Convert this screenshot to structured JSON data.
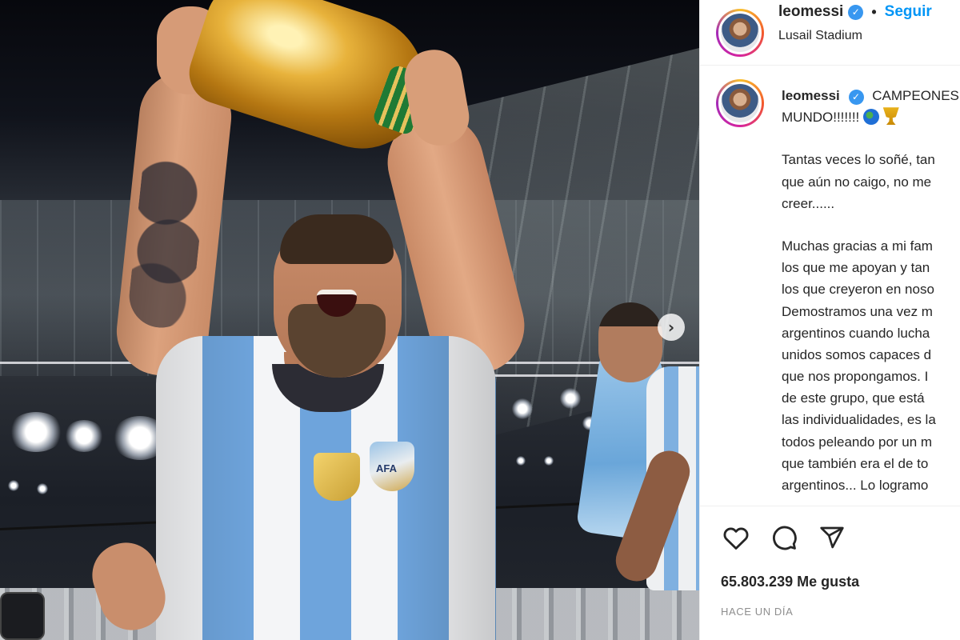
{
  "post": {
    "username": "leomessi",
    "verified_mark": "✓",
    "separator": "•",
    "follow_label": "Seguir",
    "location": "Lusail Stadium"
  },
  "caption": {
    "username": "leomessi",
    "first_line_a": "CAMPEONES",
    "first_line_b": "MUNDO!!!!!!!",
    "emoji_globe": "globe-emoji",
    "emoji_trophy": "trophy-emoji",
    "para1": [
      "Tantas veces lo soñé, tan",
      "que aún no caigo, no me",
      "creer......"
    ],
    "para2": [
      "Muchas gracias a mi fam",
      "los que me apoyan y tan",
      "los que creyeron en noso",
      "Demostramos una vez m",
      "argentinos cuando lucha",
      "unidos somos capaces d",
      "que nos propongamos. I",
      "de este grupo, que está",
      "las individualidades, es la",
      "todos peleando por un m",
      "que también era el de to",
      "argentinos... Lo logramo"
    ]
  },
  "photo": {
    "jersey_badge_text": "AFA",
    "next_arrow": "›"
  },
  "actions": {
    "icons": [
      "heart-icon",
      "comment-icon",
      "share-icon"
    ],
    "likes_text": "65.803.239 Me gusta",
    "time_text": "HACE UN DÍA"
  },
  "colors": {
    "accent_blue": "#0095f6",
    "verified_blue": "#3897f0",
    "text": "#262626",
    "muted": "#8e8e8e"
  }
}
